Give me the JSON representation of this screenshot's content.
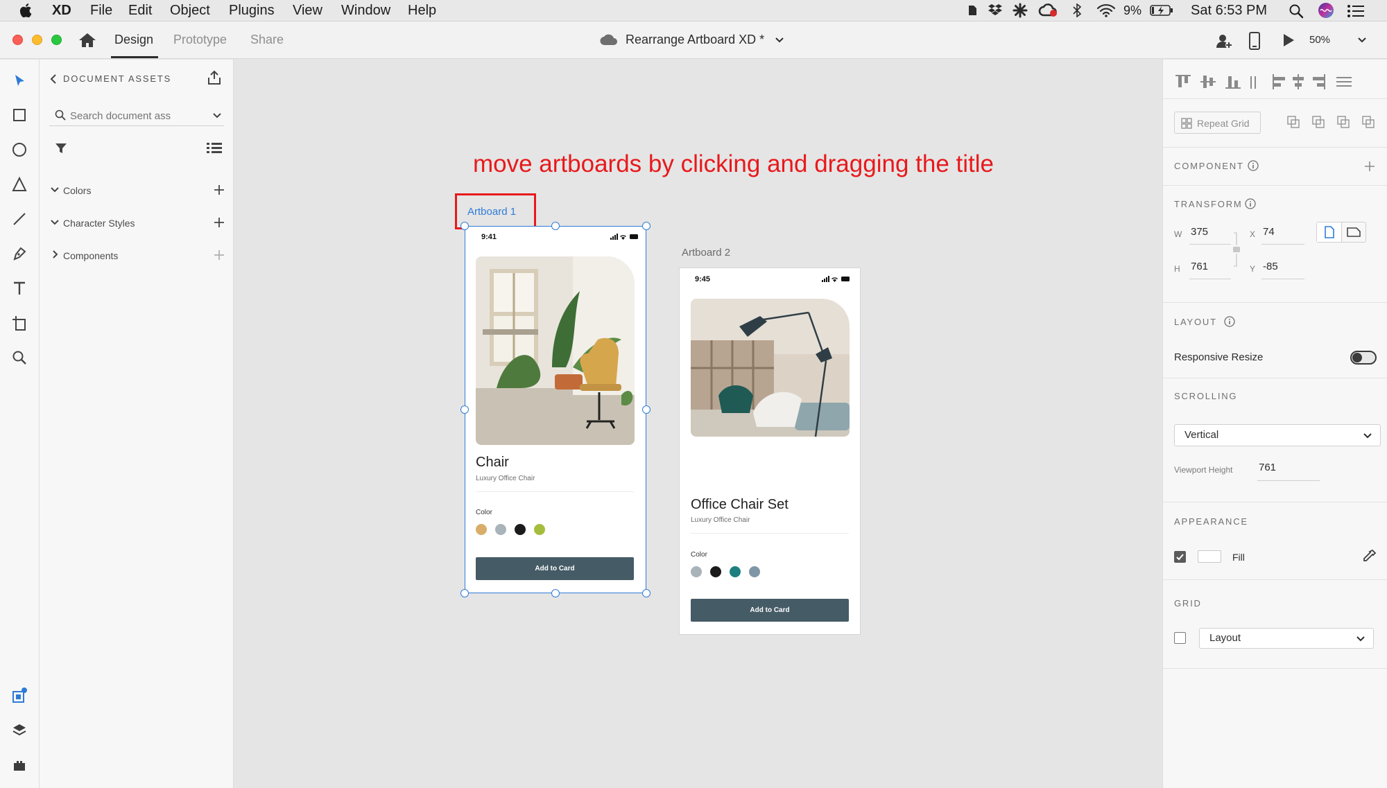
{
  "menubar": {
    "app": "XD",
    "items": [
      "File",
      "Edit",
      "Object",
      "Plugins",
      "View",
      "Window",
      "Help"
    ],
    "battery": "9%",
    "clock": "Sat 6:53 PM"
  },
  "toolbar": {
    "tabs": [
      "Design",
      "Prototype",
      "Share"
    ],
    "active_tab": "Design",
    "doc_title": "Rearrange Artboard XD *",
    "zoom": "50%"
  },
  "assets": {
    "title": "DOCUMENT ASSETS",
    "search_placeholder": "Search document ass",
    "sections": [
      "Colors",
      "Character Styles",
      "Components"
    ]
  },
  "canvas": {
    "annotation": "move artboards by clicking and dragging the title",
    "annotation_color": "#e8191c",
    "selection_color": "#2f7bd8",
    "artboard1": {
      "title": "Artboard 1",
      "time": "9:41",
      "product": "Chair",
      "subtitle": "Luxury Office Chair",
      "color_label": "Color",
      "swatches": [
        "#d8ae6a",
        "#a9b3ba",
        "#1b1b1b",
        "#a5bd3c"
      ],
      "cta": "Add to Card"
    },
    "artboard2": {
      "title": "Artboard 2",
      "time": "9:45",
      "product": "Office Chair Set",
      "subtitle": "Luxury Office Chair",
      "color_label": "Color",
      "swatches": [
        "#a9b3ba",
        "#1b1b1b",
        "#1f7f80",
        "#7f96a6"
      ],
      "cta": "Add to Card"
    }
  },
  "inspector": {
    "repeat_grid": "Repeat Grid",
    "component": "COMPONENT",
    "transform": "TRANSFORM",
    "w_label": "W",
    "w": "375",
    "x_label": "X",
    "x": "74",
    "h_label": "H",
    "h": "761",
    "y_label": "Y",
    "y": "-85",
    "layout": "LAYOUT",
    "responsive_resize": "Responsive Resize",
    "responsive_resize_on": false,
    "scrolling": "SCROLLING",
    "scroll_mode": "Vertical",
    "viewport_height_label": "Viewport Height",
    "viewport_height": "761",
    "appearance": "APPEARANCE",
    "fill_label": "Fill",
    "fill_checked": true,
    "grid": "GRID",
    "grid_mode": "Layout",
    "grid_checked": false
  }
}
